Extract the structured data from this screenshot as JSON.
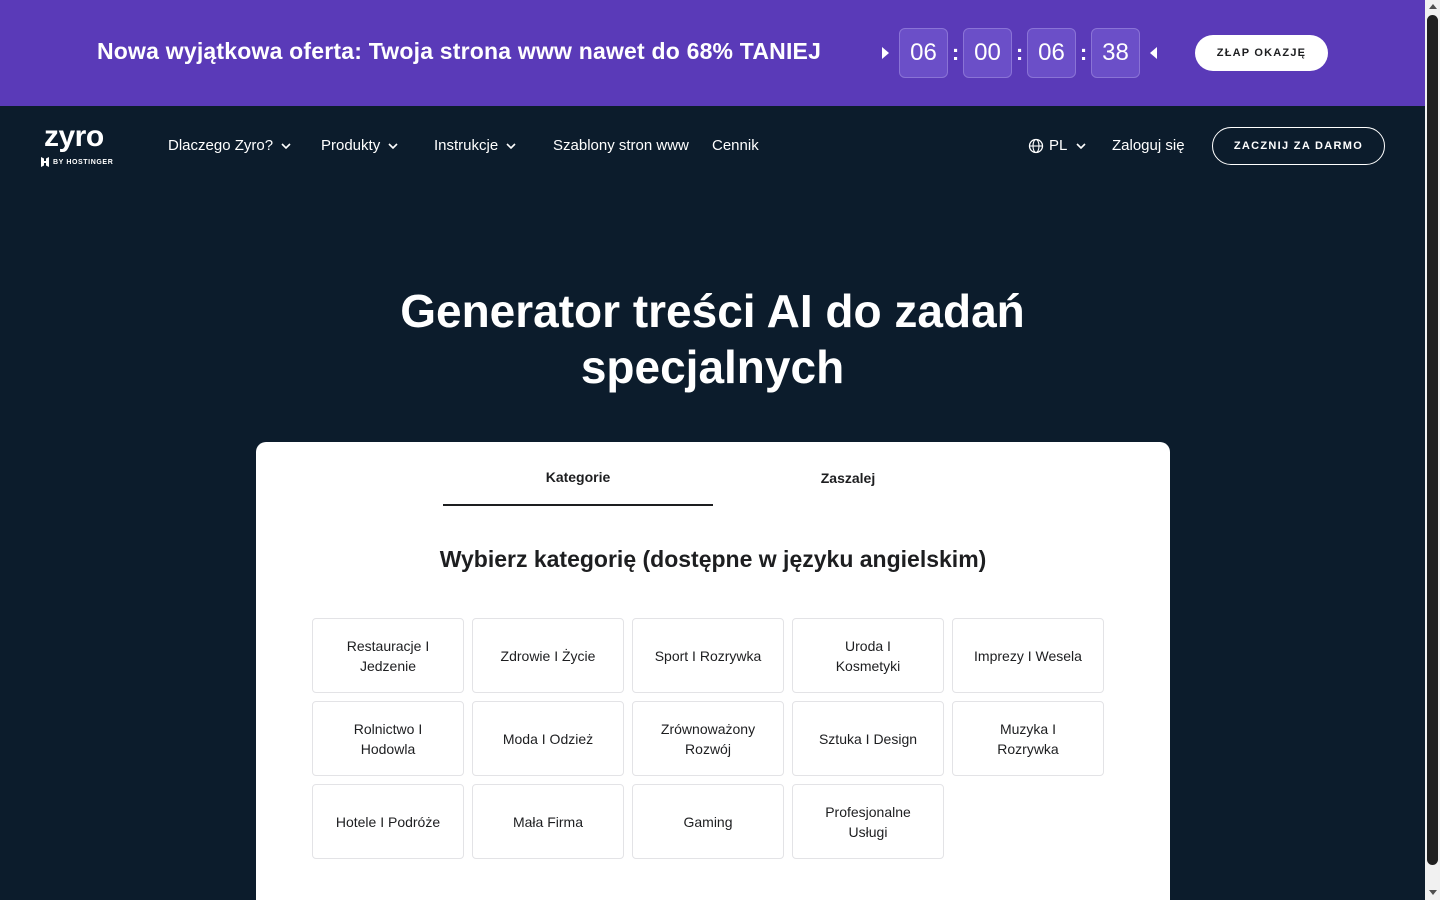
{
  "promo": {
    "text": "Nowa wyjątkowa oferta: Twoja strona www nawet do 68% TANIEJ",
    "countdown": [
      "06",
      "00",
      "06",
      "38"
    ],
    "cta": "ZŁAP OKAZJĘ",
    "bg_color": "#5a3ab8"
  },
  "nav": {
    "logo_main": "zyro",
    "logo_sub": "BY HOSTINGER",
    "items": [
      "Dlaczego Zyro?",
      "Produkty",
      "Instrukcje",
      "Szablony stron www",
      "Cennik"
    ],
    "lang": "PL",
    "login": "Zaloguj się",
    "cta": "ZACZNIJ ZA DARMO"
  },
  "hero": {
    "title_line1": "Generator treści AI do zadań",
    "title_line2": "specjalnych"
  },
  "card": {
    "tabs": [
      "Kategorie",
      "Zaszalej"
    ],
    "title": "Wybierz kategorię (dostępne w języku angielskim)",
    "categories": [
      "Restauracje I Jedzenie",
      "Zdrowie I Życie",
      "Sport I Rozrywka",
      "Uroda I Kosmetyki",
      "Imprezy I Wesela",
      "Rolnictwo I Hodowla",
      "Moda I Odzież",
      "Zrównoważony Rozwój",
      "Sztuka I Design",
      "Muzyka I Rozrywka",
      "Hotele I Podróże",
      "Mała Firma",
      "Gaming",
      "Profesjonalne Usługi"
    ]
  },
  "colors": {
    "page_bg": "#0c1c2c",
    "card_bg": "#ffffff",
    "text_dark": "#1d1e20"
  }
}
